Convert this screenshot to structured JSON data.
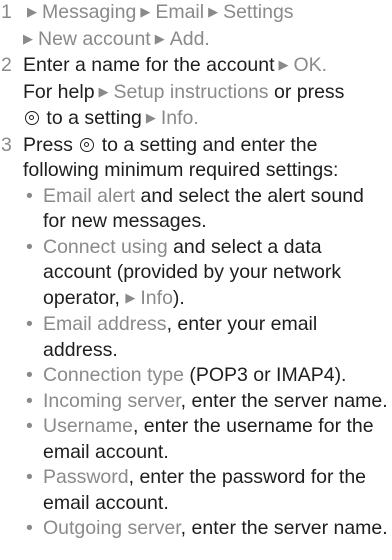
{
  "steps": [
    {
      "num": "1",
      "parts": [
        "Messaging",
        "Email",
        "Settings",
        "New account",
        "Add."
      ]
    },
    {
      "num": "2",
      "text_a": "Enter a name for the account",
      "ok": "OK.",
      "text_b": "For help",
      "setup": "Setup instructions",
      "text_c": "or press",
      "text_d": "to a setting",
      "info": "Info."
    },
    {
      "num": "3",
      "text_a": "Press",
      "text_b": "to a setting and enter the following minimum required settings:",
      "bullets": [
        {
          "term": "Email alert",
          "rest": " and select the alert sound for new messages."
        },
        {
          "term": "Connect using",
          "rest": " and select a data account (provided by your network operator, ",
          "info": "Info",
          "rest2": ")."
        },
        {
          "term": "Email address",
          "rest": ", enter your email address."
        },
        {
          "term": "Connection type",
          "rest": " (POP3 or IMAP4)."
        },
        {
          "term": "Incoming server",
          "rest": ", enter the server name."
        },
        {
          "term": "Username",
          "rest": ", enter the username for the email account."
        },
        {
          "term": "Password",
          "rest": ", enter the password for the email account."
        },
        {
          "term": "Outgoing server",
          "rest": ", enter the server name."
        }
      ]
    }
  ],
  "icons": {
    "arrow": "right-triangle-icon",
    "navigation_key": "navigation-key-icon"
  },
  "colors": {
    "text": "#1e1e1e",
    "highlight": "#8a8a8a"
  }
}
